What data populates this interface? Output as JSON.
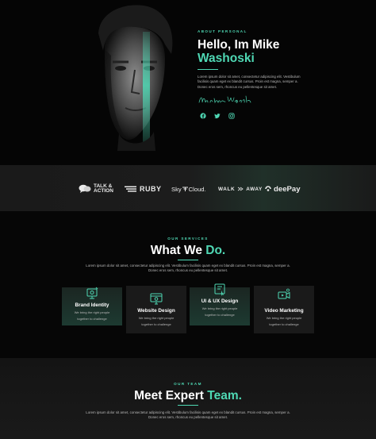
{
  "hero": {
    "eyebrow": "ABOUT PERSONAL",
    "title_line1": "Hello, Im Mike",
    "title_accent": "Washoski",
    "description": "Lorem ipsum dolor sit amet, consectetur adipiscing elit. Vestibulum facilisis quam eget ex blandit cursus. Proin est magna, semper a. Donec eros sem, rhoncus eu pellentesque sit amet.",
    "signature": "Mike Washoski",
    "social_icons": [
      "facebook-icon",
      "twitter-icon",
      "instagram-icon"
    ]
  },
  "logos": [
    {
      "name": "TALK & ACTION",
      "line1": "TALK &",
      "line2": "ACTION"
    },
    {
      "name": "RUBY"
    },
    {
      "name": "SkyCloud.",
      "part1": "Sky",
      "part2": "Cloud."
    },
    {
      "name": "WALK AWAY",
      "part1": "WALK",
      "part2": "AWAY"
    },
    {
      "name": "deePay"
    }
  ],
  "services": {
    "eyebrow": "OUR SERVICES",
    "title": "What We",
    "title_accent": "Do.",
    "description": "Lorem ipsum dolor sit amet, consectetur adipiscing elit. Vestibulum facilisis quam eget ex blandit cursus. Proin est magna, semper a. Donec eros sem, rhoncus eu pellentesque sit amet.",
    "cards": [
      {
        "title": "Brand Identity",
        "text": "We bring the right people together to challenge",
        "icon": "brand-identity-icon"
      },
      {
        "title": "Website Design",
        "text": "We bring the right people together to challenge",
        "icon": "website-design-icon"
      },
      {
        "title": "UI & UX Design",
        "text": "We bring the right people together to challenge",
        "icon": "ui-ux-design-icon"
      },
      {
        "title": "Video Marketing",
        "text": "We bring the right people together to challenge",
        "icon": "video-marketing-icon"
      }
    ]
  },
  "team": {
    "eyebrow": "OUR TEAM",
    "title": "Meet Expert",
    "title_accent": "Team.",
    "description": "Lorem ipsum dolor sit amet, consectetur adipiscing elit. Vestibulum facilisis quam eget ex blandit cursus. Proin est magna, semper a. Donec eros sem, rhoncus eu pellentesque sit amet."
  },
  "colors": {
    "accent": "#4fd8b4",
    "background": "#060606",
    "card": "#1a1a1a"
  }
}
